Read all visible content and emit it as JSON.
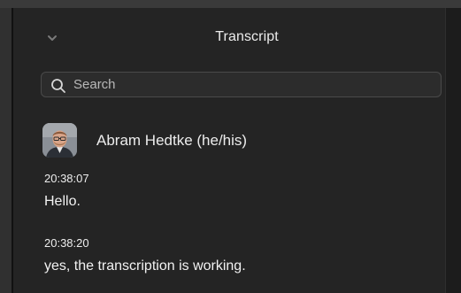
{
  "header": {
    "title": "Transcript"
  },
  "search": {
    "placeholder": "Search",
    "value": ""
  },
  "speaker": {
    "name": "Abram Hedtke (he/his)"
  },
  "entries": [
    {
      "time": "20:38:07",
      "text": "Hello."
    },
    {
      "time": "20:38:20",
      "text": "yes, the transcription is working."
    }
  ],
  "icons": {
    "collapse": "chevron-down-icon",
    "search": "search-icon"
  }
}
